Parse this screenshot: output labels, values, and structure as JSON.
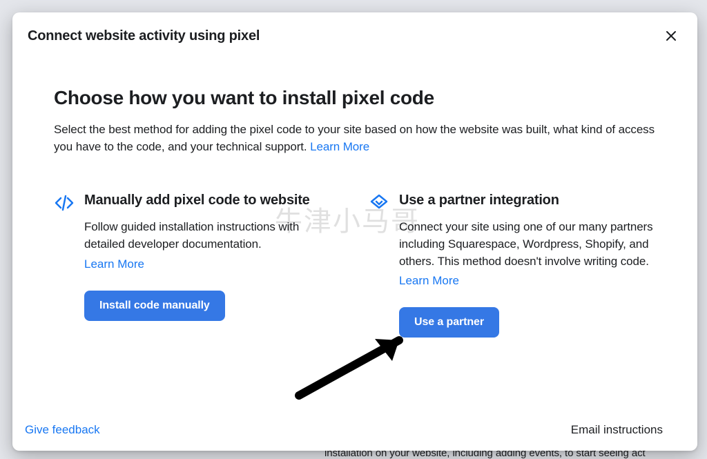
{
  "background": {
    "bottom_text": "installation on your website, including adding events, to start seeing act"
  },
  "modal": {
    "title": "Connect website activity using pixel",
    "section_title": "Choose how you want to install pixel code",
    "section_desc": "Select the best method for adding the pixel code to your site based on how the website was built, what kind of access you have to the code, and your technical support. ",
    "learn_more": "Learn More",
    "option1": {
      "title": "Manually add pixel code to website",
      "desc": "Follow guided installation instructions with detailed developer documentation.",
      "link": "Learn More",
      "button": "Install code manually"
    },
    "option2": {
      "title": "Use a partner integration",
      "desc": "Connect your site using one of our many partners including Squarespace, Wordpress, Shopify, and others. This method doesn't involve writing code.",
      "link": "Learn More",
      "button": "Use a partner"
    },
    "feedback": "Give feedback",
    "email": "Email instructions"
  },
  "watermark": "牛津小马哥"
}
